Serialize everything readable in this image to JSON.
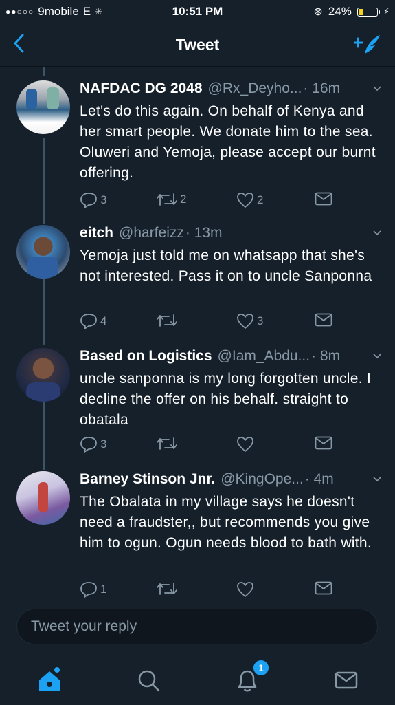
{
  "status_bar": {
    "carrier": "9mobile",
    "network": "E",
    "time": "10:51 PM",
    "battery": "24%",
    "battery_level": 0.24
  },
  "nav": {
    "title": "Tweet",
    "back_icon": "chevron-left-icon",
    "compose_icon": "compose-tweet-icon"
  },
  "tweets": [
    {
      "name": "NAFDAC DG 2048",
      "handle": "@Rx_Deyho...",
      "time": "· 16m",
      "text": "Let's do this again. On behalf of Kenya and her smart people. We donate him to the sea. Oluweri and Yemoja, please accept our burnt offering.",
      "replies": "3",
      "retweets": "2",
      "likes": "2"
    },
    {
      "name": "eitch",
      "handle": "@harfeizz",
      "time": "· 13m",
      "text": "Yemoja just told me on whatsapp that she's not interested. Pass it on to uncle Sanponna",
      "replies": "4",
      "retweets": "",
      "likes": "3"
    },
    {
      "name": "Based on Logistics",
      "handle": "@Iam_Abdu...",
      "time": "· 8m",
      "text": "uncle sanponna is my long forgotten uncle. I decline the offer on his behalf. straight to obatala",
      "replies": "3",
      "retweets": "",
      "likes": ""
    },
    {
      "name": "Barney Stinson Jnr.",
      "handle": "@KingOpe...",
      "time": "· 4m",
      "text": "The Obalata in my village says he doesn't need a fraudster,, but recommends you give him to ogun. Ogun needs blood to bath with.",
      "replies": "1",
      "retweets": "",
      "likes": ""
    }
  ],
  "reply": {
    "placeholder": "Tweet your reply"
  },
  "tabs": {
    "home_icon": "home-icon",
    "search_icon": "search-icon",
    "notifications_icon": "bell-icon",
    "notifications_badge": "1",
    "messages_icon": "mail-icon"
  },
  "colors": {
    "background": "#15202b",
    "accent": "#1da1f2",
    "secondary_text": "#8899a6"
  }
}
